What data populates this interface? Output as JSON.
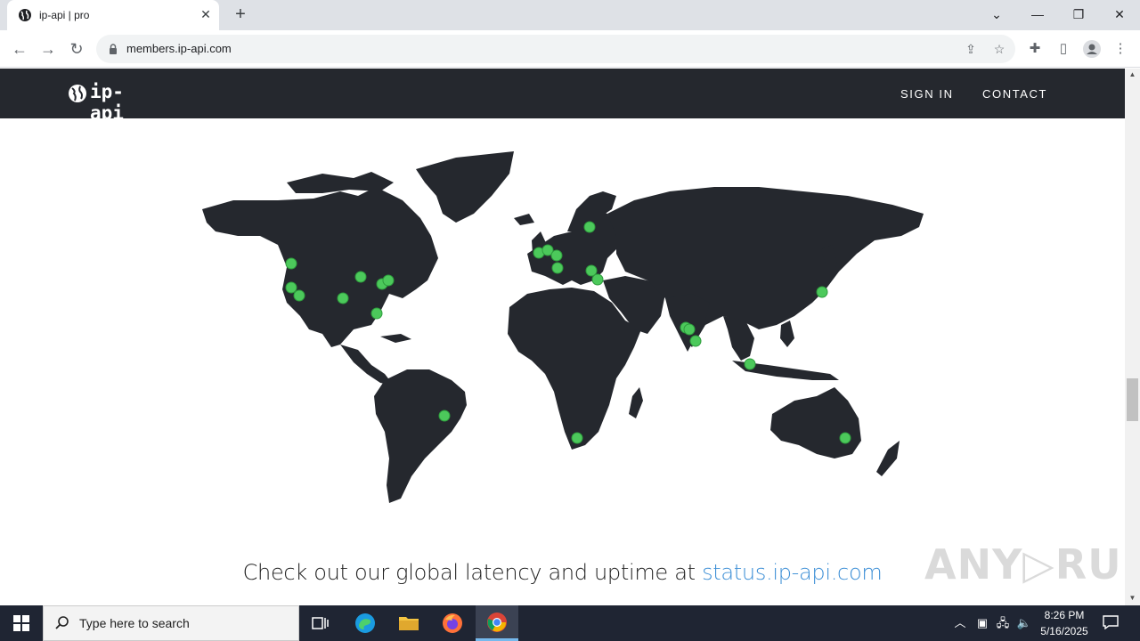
{
  "browser": {
    "tab_title": "ip-api | pro",
    "tab_close": "✕",
    "new_tab": "+",
    "url": "members.ip-api.com",
    "window_controls": {
      "dropdown": "⌄",
      "minimize": "—",
      "restore": "❐",
      "close": "✕"
    }
  },
  "site": {
    "logo_text": "ip-api",
    "nav": {
      "sign_in": "SIGN IN",
      "contact": "CONTACT"
    },
    "tagline_prefix": "Check out our global latency and uptime at ",
    "tagline_link": "status.ip-api.com",
    "marker_color": "#4cc95b",
    "land_color": "#25282e"
  },
  "watermark": "ANY▷RUN",
  "taskbar": {
    "search_placeholder": "Type here to search",
    "time": "8:26 PM",
    "date": "5/16/2025"
  }
}
